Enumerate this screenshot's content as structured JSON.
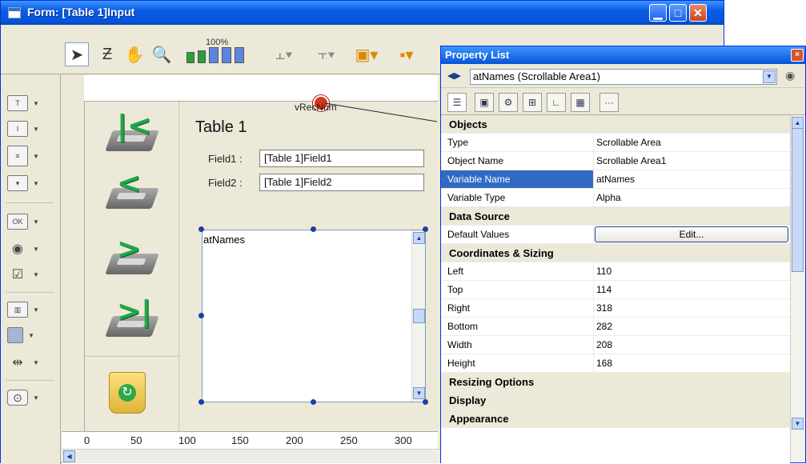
{
  "window": {
    "title": "Form: [Table 1]Input"
  },
  "toolbar": {
    "zoom_label": "100%"
  },
  "form": {
    "title": "Table 1",
    "record_number_var": "vRecNum",
    "field1_label": "Field1 :",
    "field1_value": "[Table 1]Field1",
    "field2_label": "Field2 :",
    "field2_value": "[Table 1]Field2",
    "area_text": "atNames",
    "nav_buttons": [
      {
        "icon": "first-record-icon",
        "glyph": "|<"
      },
      {
        "icon": "previous-record-icon",
        "glyph": "<"
      },
      {
        "icon": "next-record-icon",
        "glyph": ">"
      },
      {
        "icon": "last-record-icon",
        "glyph": ">|"
      }
    ]
  },
  "ruler": {
    "ticks": [
      "0",
      "50",
      "100",
      "150",
      "200",
      "250",
      "300"
    ]
  },
  "left_toolbar": {
    "items": [
      "text-tool-icon",
      "field-tool-icon",
      "list-tool-icon",
      "dropdown-tool-icon",
      "button-tool-icon",
      "radio-tool-icon",
      "checkbox-tool-icon",
      "progress-tool-icon",
      "rectangle-tool-icon",
      "splitter-tool-icon",
      "plugin-tool-icon"
    ],
    "ok_label": "OK",
    "text_label": "T"
  },
  "property_list": {
    "title": "Property List",
    "selected_object": "atNames (Scrollable Area1)",
    "close_glyph": "×",
    "sections": {
      "objects": "Objects",
      "data_source": "Data Source",
      "coordinates": "Coordinates & Sizing",
      "resizing": "Resizing Options",
      "display": "Display",
      "appearance": "Appearance"
    },
    "rows": {
      "type": {
        "key": "Type",
        "value": "Scrollable Area"
      },
      "object_name": {
        "key": "Object Name",
        "value": "Scrollable Area1"
      },
      "variable_name": {
        "key": "Variable Name",
        "value": "atNames"
      },
      "variable_type": {
        "key": "Variable Type",
        "value": "Alpha"
      },
      "default_values": {
        "key": "Default Values",
        "button": "Edit..."
      },
      "left": {
        "key": "Left",
        "value": "110"
      },
      "top": {
        "key": "Top",
        "value": "114"
      },
      "right": {
        "key": "Right",
        "value": "318"
      },
      "bottom": {
        "key": "Bottom",
        "value": "282"
      },
      "width": {
        "key": "Width",
        "value": "208"
      },
      "height": {
        "key": "Height",
        "value": "168"
      }
    }
  }
}
